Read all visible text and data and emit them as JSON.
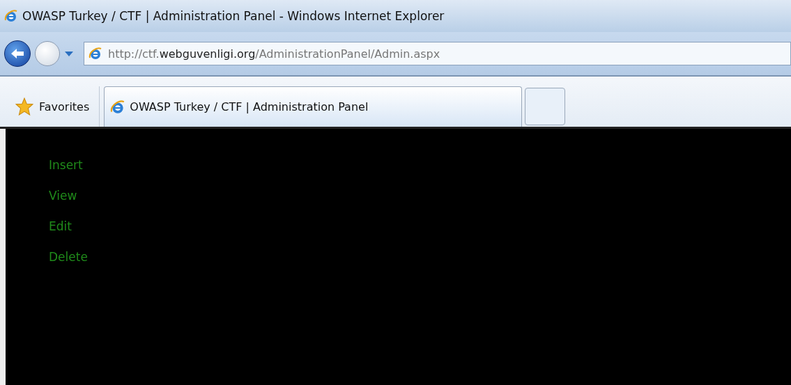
{
  "window": {
    "title": "OWASP Turkey / CTF | Administration Panel - Windows Internet Explorer"
  },
  "address_bar": {
    "url_parts": [
      {
        "text": "http://ctf.",
        "emphasized": false
      },
      {
        "text": "webguvenligi.org",
        "emphasized": true
      },
      {
        "text": "/AdministrationPanel/Admin.aspx",
        "emphasized": false
      }
    ]
  },
  "favorites": {
    "label": "Favorites"
  },
  "tabs": [
    {
      "label": "OWASP Turkey / CTF | Administration Panel",
      "selected": true
    }
  ],
  "page": {
    "menu": [
      {
        "label": "Insert"
      },
      {
        "label": "View"
      },
      {
        "label": "Edit"
      },
      {
        "label": "Delete"
      }
    ]
  }
}
